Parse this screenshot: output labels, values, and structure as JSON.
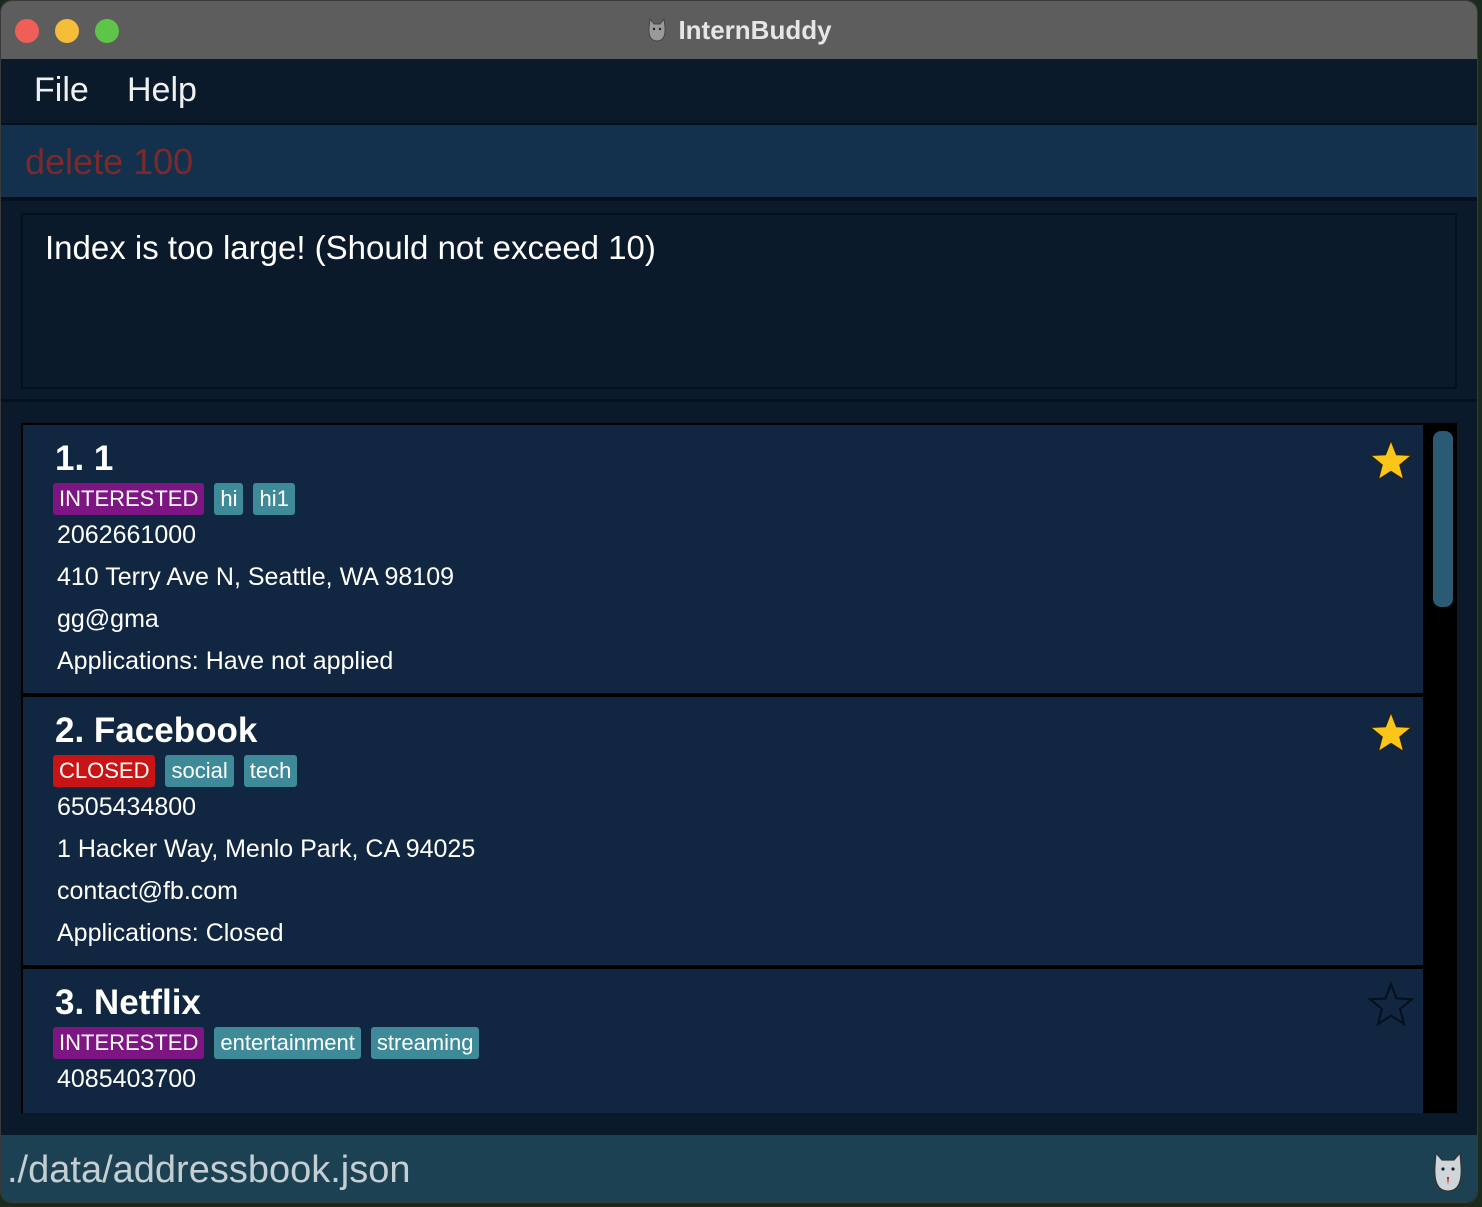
{
  "window": {
    "title": "InternBuddy",
    "title_icon": "cat-icon"
  },
  "menu": {
    "file_label": "File",
    "help_label": "Help"
  },
  "command": {
    "value": "delete 100"
  },
  "result": {
    "message": "Index is too large! (Should not exceed 10)"
  },
  "companies": [
    {
      "title": "1. 1",
      "status": "INTERESTED",
      "tags": [
        "hi",
        "hi1"
      ],
      "phone": "2062661000",
      "address": "410 Terry Ave N, Seattle, WA 98109",
      "email": "gg@gma",
      "applications": "Applications: Have not applied",
      "favourite": true
    },
    {
      "title": "2. Facebook",
      "status": "CLOSED",
      "tags": [
        "social",
        "tech"
      ],
      "phone": "6505434800",
      "address": "1 Hacker Way, Menlo Park, CA 94025",
      "email": "contact@fb.com",
      "applications": "Applications: Closed",
      "favourite": true
    },
    {
      "title": "3. Netflix",
      "status": "INTERESTED",
      "tags": [
        "entertainment",
        "streaming"
      ],
      "phone": "4085403700",
      "address": "",
      "email": "",
      "applications": "",
      "favourite": false
    }
  ],
  "status_bar": {
    "path": "./data/addressbook.json",
    "icon": "cat-icon"
  },
  "colors": {
    "interested": "#7d1583",
    "closed": "#c81414",
    "tag": "#3e8a99",
    "star_filled": "#f9c619"
  }
}
